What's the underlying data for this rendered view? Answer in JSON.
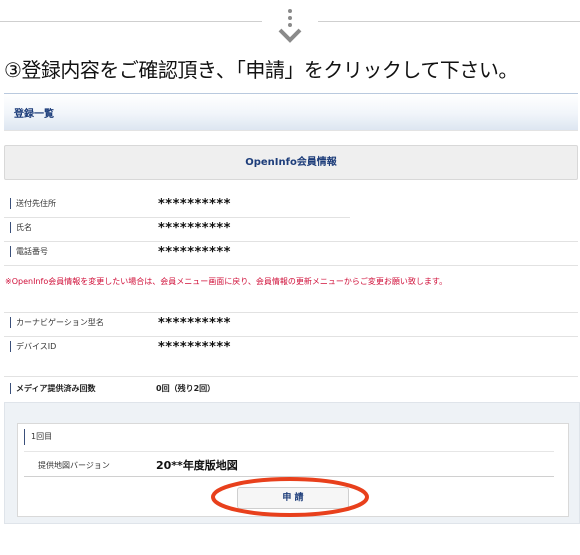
{
  "step": {
    "heading": "③登録内容をご確認頂き､「申請」をクリックして下さい。"
  },
  "list_header": {
    "title": "登録一覧"
  },
  "section": {
    "title": "OpenInfo会員情報"
  },
  "member_rows": [
    {
      "label": "送付先住所",
      "value": "**********"
    },
    {
      "label": "氏名",
      "value": "**********"
    },
    {
      "label": "電話番号",
      "value": "**********"
    }
  ],
  "notice": "※OpenInfo会員情報を変更したい場合は、会員メニュー画面に戻り、会員情報の更新メニューからご変更お願い致します。",
  "car_rows": [
    {
      "label": "カーナビゲーション型名",
      "value": "**********"
    },
    {
      "label": "デバイスID",
      "value": "**********"
    }
  ],
  "media": {
    "label": "メディア提供済み回数",
    "value": "0回（残り2回）"
  },
  "provision": {
    "title": "1回目",
    "version_label": "提供地図バージョン",
    "version_value": "20**年度版地図",
    "apply_label": "申 請"
  },
  "colors": {
    "accent_navy": "#1d3d7a",
    "notice_red": "#d0103a",
    "highlight": "#e8401c"
  },
  "icons": {
    "down_arrow": "chevron-down-double-icon"
  }
}
